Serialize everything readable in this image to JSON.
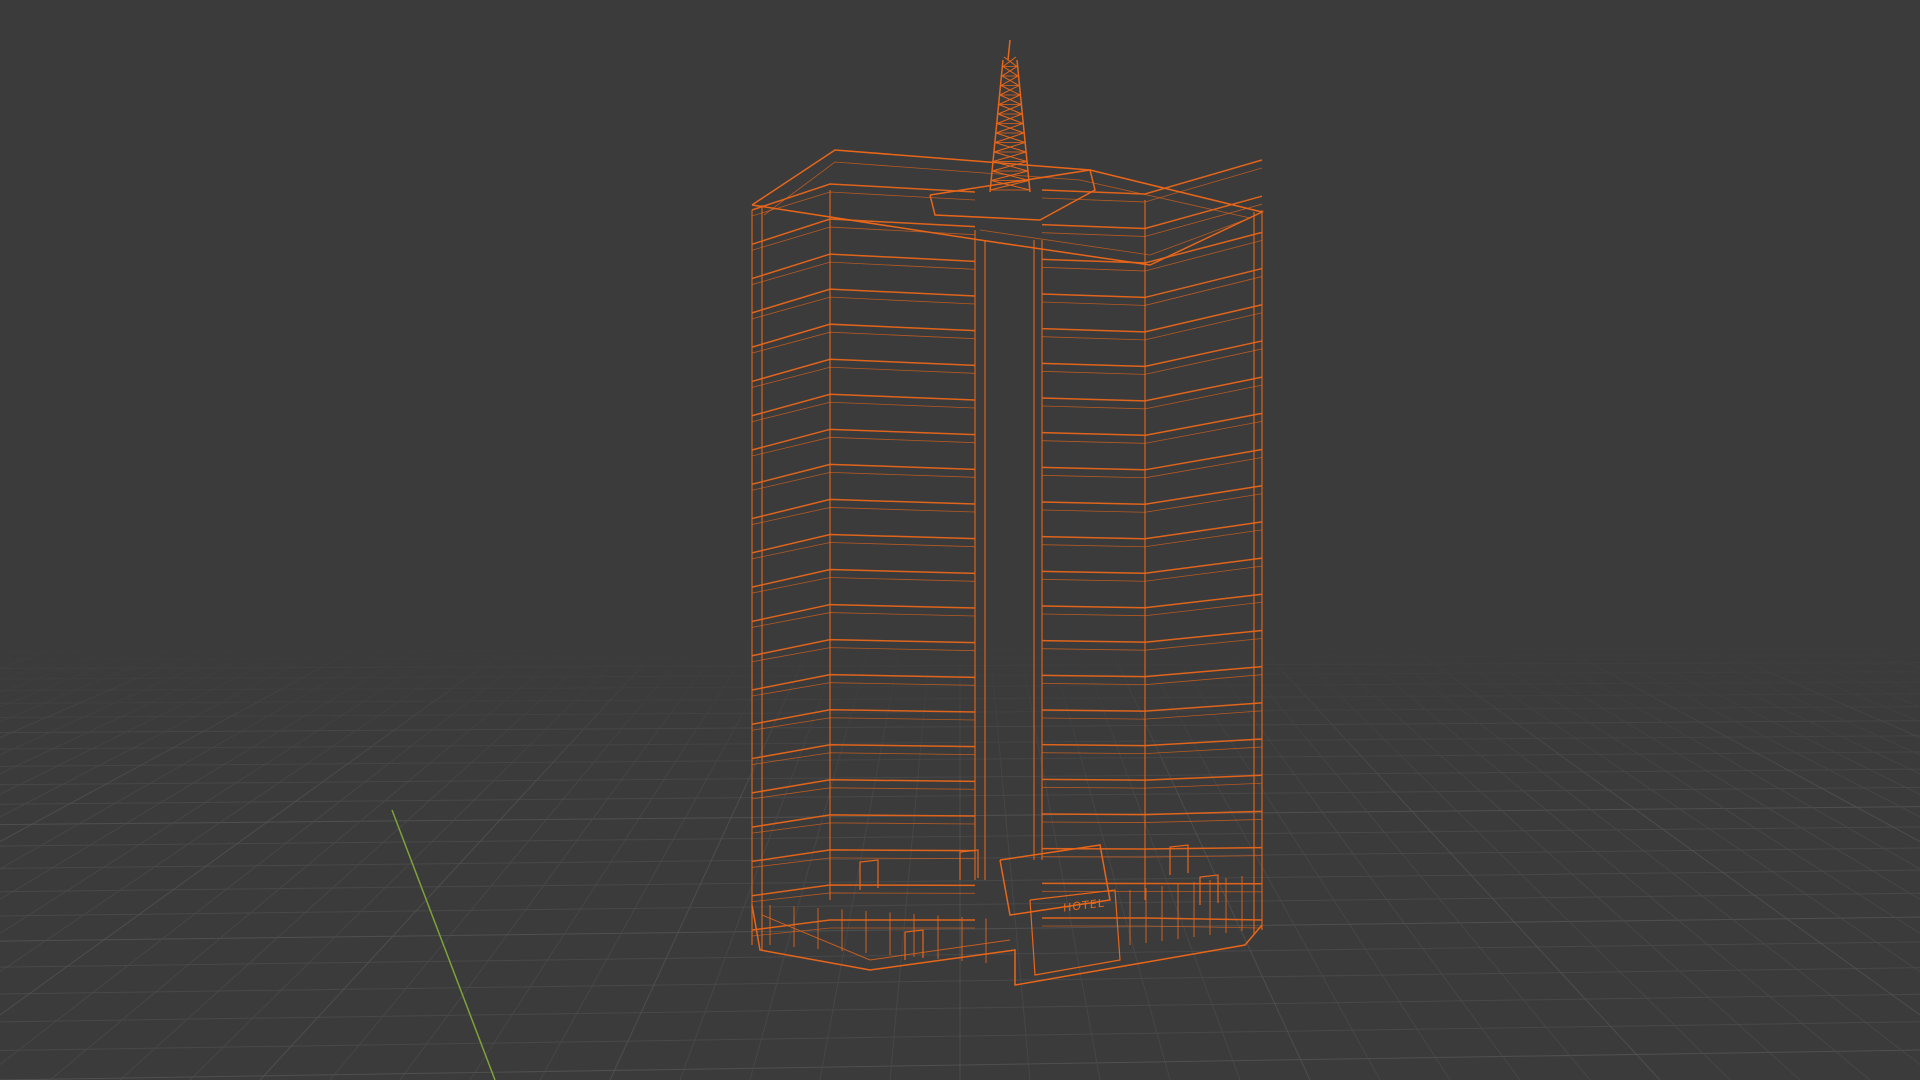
{
  "viewport": {
    "background": "#3b3b3b",
    "grid_color": "#4a4a4a",
    "grid_major_color": "#525252",
    "y_axis_color": "#7ea23a",
    "display_mode": "wireframe"
  },
  "selected_object": {
    "type": "building",
    "wire_color": "#e8661a",
    "sign_text": "HOTEL"
  }
}
